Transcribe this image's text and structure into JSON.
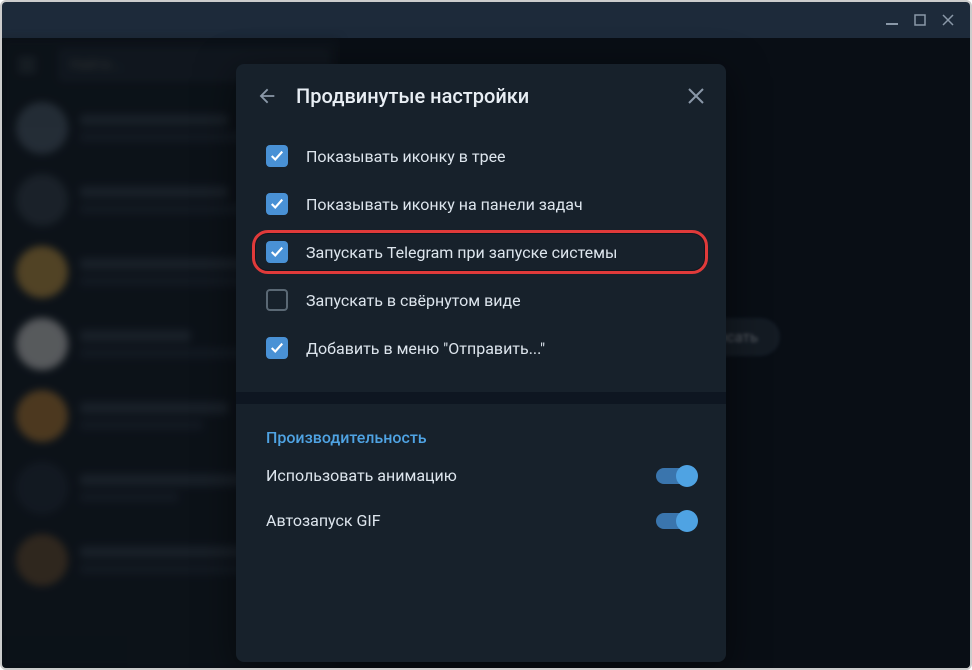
{
  "search_placeholder": "Найти...",
  "main_button_label": "аписать",
  "dialog": {
    "title": "Продвинутые настройки",
    "options": [
      {
        "label": "Показывать иконку в трее",
        "checked": true,
        "highlighted": false
      },
      {
        "label": "Показывать иконку на панели задач",
        "checked": true,
        "highlighted": false
      },
      {
        "label": "Запускать Telegram при запуске системы",
        "checked": true,
        "highlighted": true
      },
      {
        "label": "Запускать в свёрнутом виде",
        "checked": false,
        "highlighted": false
      },
      {
        "label": "Добавить в меню \"Отправить...\"",
        "checked": true,
        "highlighted": false
      }
    ],
    "performance_header": "Производительность",
    "toggles": [
      {
        "label": "Использовать анимацию",
        "on": true
      },
      {
        "label": "Автозапуск GIF",
        "on": true
      }
    ]
  }
}
